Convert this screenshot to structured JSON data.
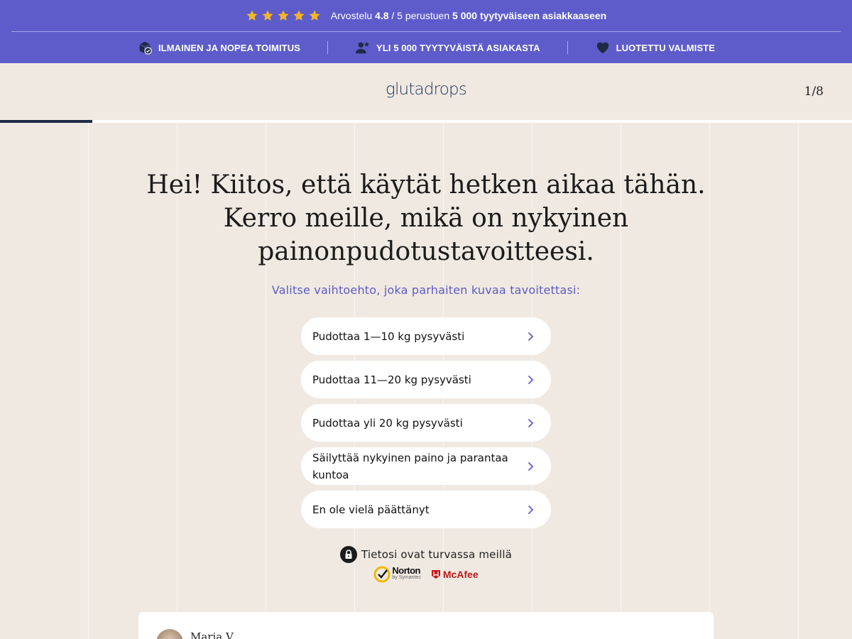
{
  "promo": {
    "rating_prefix": "Arvostelu",
    "rating_value": "4.8",
    "rating_mid": "/ 5 perustuen",
    "rating_bold": "5 000 tyytyväiseen asiakkaaseen",
    "star_count": 5,
    "star_color": "#f5b524",
    "background": "#5e5ccb",
    "features": [
      {
        "icon": "shipping-box-icon",
        "label": "ILMAINEN JA NOPEA TOIMITUS"
      },
      {
        "icon": "users-star-icon",
        "label": "YLI 5 000 TYYTYVÄISTÄ ASIAKASTA"
      },
      {
        "icon": "heart-icon",
        "label": "LUOTETTU VALMISTE"
      }
    ]
  },
  "header": {
    "logo": "glutadrops",
    "step": "1/8",
    "progress": 0.108
  },
  "main": {
    "title": "Hei! Kiitos, että käytät hetken aikaa tähän. Kerro meille, mikä on nykyinen painonpudotustavoitteesi.",
    "subtitle": "Valitse vaihtoehto, joka parhaiten kuvaa tavoitettasi:",
    "options": [
      "Pudottaa 1—10 kg pysyvästi",
      "Pudottaa 11—20 kg pysyvästi",
      "Pudottaa yli 20 kg pysyvästi",
      "Säilyttää nykyinen paino ja parantaa kuntoa",
      "En ole vielä päättänyt"
    ],
    "secure_text": "Tietosi ovat turvassa meillä",
    "trust_badges": {
      "norton_name": "Norton",
      "norton_by": "by Symantec",
      "mcafee": "McAfee"
    }
  },
  "review": {
    "name": "Maria V."
  }
}
